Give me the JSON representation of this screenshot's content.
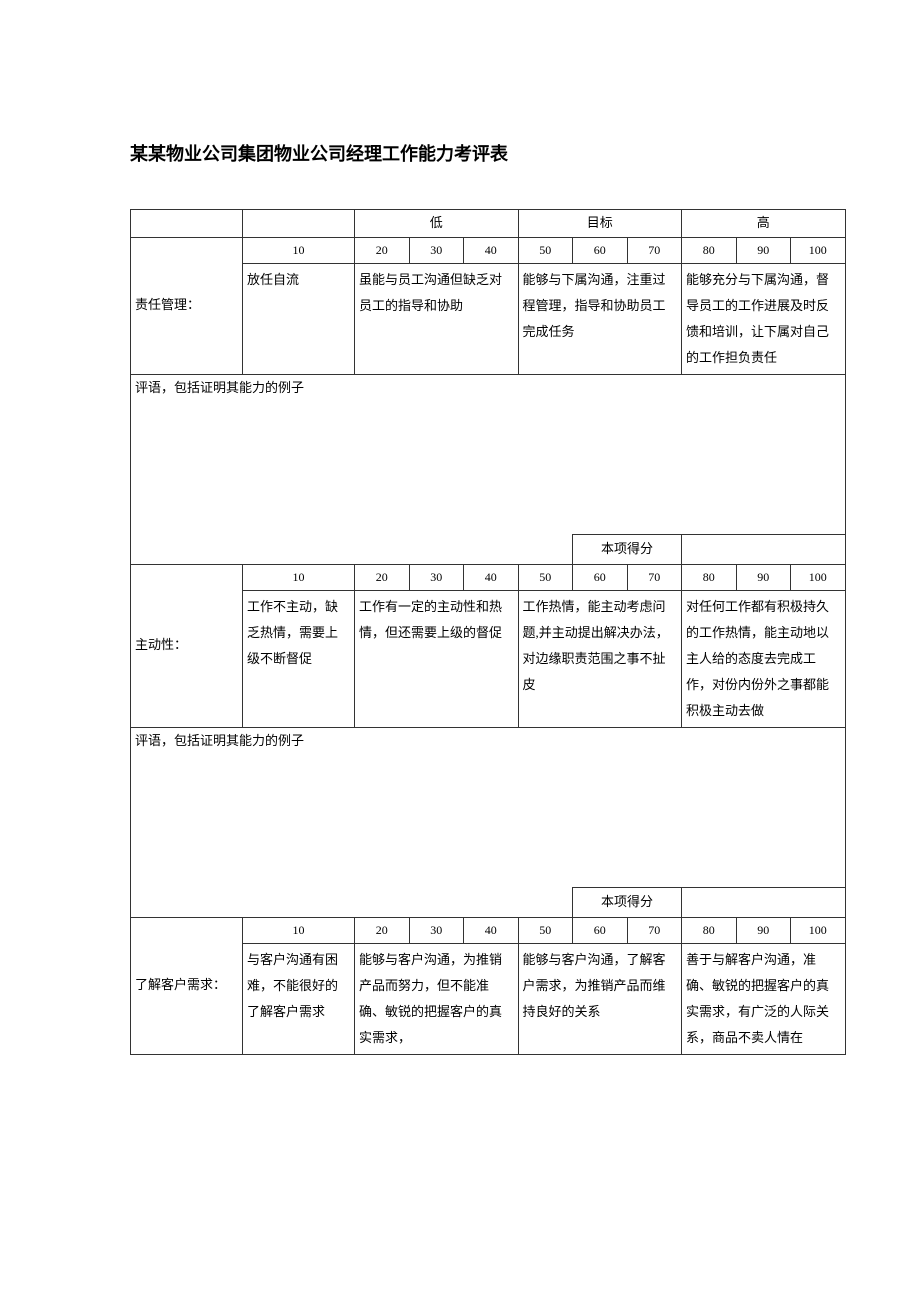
{
  "title": "某某物业公司集团物业公司经理工作能力考评表",
  "headers": {
    "low": "低",
    "target": "目标",
    "high": "高"
  },
  "scale": [
    "10",
    "20",
    "30",
    "40",
    "50",
    "60",
    "70",
    "80",
    "90",
    "100"
  ],
  "comment_label": "评语，包括证明其能力的例子",
  "score_label": "本项得分",
  "sections": [
    {
      "label": "责任管理：",
      "levels": [
        "放任自流",
        "虽能与员工沟通但缺乏对员工的指导和协助",
        "能够与下属沟通，注重过程管理，指导和协助员工完成任务",
        "能够充分与下属沟通，督导员工的工作进展及时反馈和培训，让下属对自己的工作担负责任"
      ]
    },
    {
      "label": "主动性：",
      "levels": [
        "工作不主动，缺乏热情，需要上级不断督促",
        "工作有一定的主动性和热情，但还需要上级的督促",
        "工作热情，能主动考虑问题,并主动提出解决办法，对边缘职责范围之事不扯皮",
        "对任何工作都有积极持久的工作热情，能主动地以主人给的态度去完成工作，对份内份外之事都能积极主动去做"
      ]
    },
    {
      "label": "了解客户需求：",
      "levels": [
        "与客户沟通有困难，不能很好的了解客户需求",
        "能够与客户沟通，为推销产品而努力，但不能准确、敏锐的把握客户的真实需求，",
        "能够与客户沟通，了解客户需求，为推销产品而维持良好的关系",
        "善于与解客户沟通，准确、敏锐的把握客户的真实需求，有广泛的人际关系，商品不卖人情在"
      ]
    }
  ]
}
